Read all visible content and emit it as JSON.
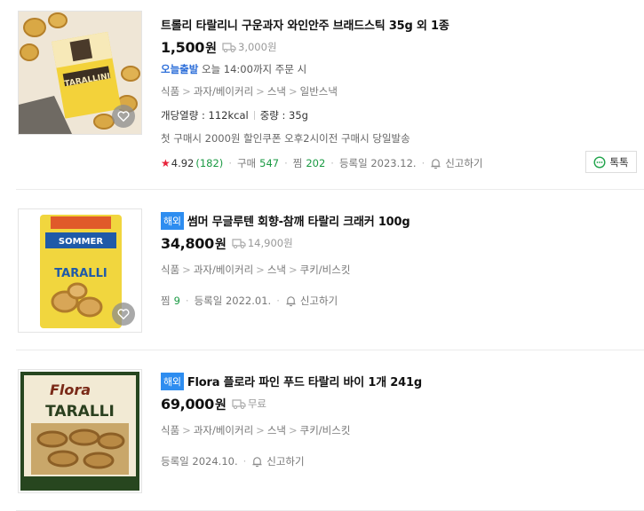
{
  "products": [
    {
      "title": "트롤리 타랄리니 구운과자 와인안주 브래드스틱 35g 외 1종",
      "overseas_badge": "",
      "price": "1,500",
      "won": "원",
      "shipping": "3,000원",
      "today_label": "오늘출발",
      "today_desc": "오늘 14:00까지 주문 시",
      "categories": [
        "식품",
        "과자/베이커리",
        "스낵",
        "일반스낵"
      ],
      "spec_kcal": "개당열량 : 112kcal",
      "spec_weight": "중량 : 35g",
      "promo": "첫 구매시 2000원 할인쿠폰 오후2시이전 구매시 당일발송",
      "rating": "4.92",
      "rating_count": "(182)",
      "purchase_label": "구매",
      "purchase_count": "547",
      "wish_label": "찜",
      "wish_count": "202",
      "registered": "등록일 2023.12.",
      "report": "신고하기",
      "talk": "톡톡"
    },
    {
      "title": "썸머 무글루텐 회향-참깨 타랄리 크래커 100g",
      "overseas_badge": "해외",
      "price": "34,800",
      "won": "원",
      "shipping": "14,900원",
      "categories": [
        "식품",
        "과자/베이커리",
        "스낵",
        "쿠키/비스킷"
      ],
      "wish_label": "찜",
      "wish_count": "9",
      "registered": "등록일 2022.01.",
      "report": "신고하기"
    },
    {
      "title": "Flora 플로라 파인 푸드 타랄리 바이 1개 241g",
      "overseas_badge": "해외",
      "price": "69,000",
      "won": "원",
      "shipping": "무료",
      "categories": [
        "식품",
        "과자/베이커리",
        "스낵",
        "쿠키/비스킷"
      ],
      "registered": "등록일 2024.10.",
      "report": "신고하기"
    }
  ],
  "image_text": {
    "p1_brand": "TARALLINI",
    "p2_brand": "SOMMER",
    "p2_name": "TARALLI",
    "p3_brand": "Flora",
    "p3_name": "TARALLI"
  },
  "colors": {
    "link_blue": "#2e6fd9",
    "overseas_badge": "#2e8df0",
    "count_green": "#1a9a43",
    "star_red": "#e8223a"
  },
  "icons": {
    "shipping": "truck-icon",
    "wish": "heart-icon",
    "report": "bell-icon",
    "talk": "chat-icon",
    "rating": "star-icon"
  }
}
